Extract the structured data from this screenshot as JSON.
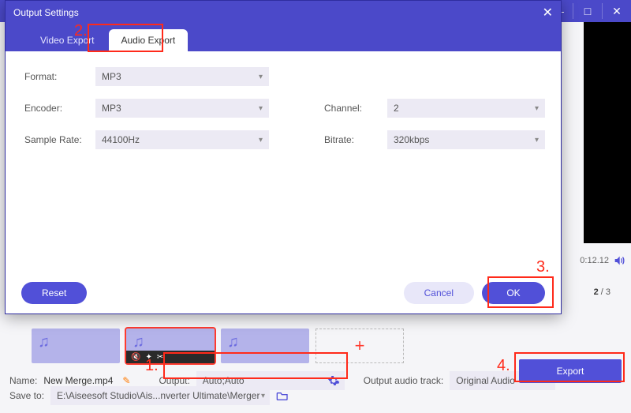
{
  "app": {
    "window_buttons": {
      "min": "—",
      "max": "□",
      "close": "✕"
    }
  },
  "preview": {
    "time": "0:12.12",
    "counter_current": "2",
    "counter_sep": " / ",
    "counter_total": "3"
  },
  "thumbs": {
    "plus": "+"
  },
  "bottom": {
    "name_label": "Name:",
    "name_value": "New Merge.mp4",
    "output_label": "Output:",
    "output_value": "Auto;Auto",
    "track_label": "Output audio track:",
    "track_value": "Original Audio",
    "export_label": "Export",
    "save_label": "Save to:",
    "save_value": "E:\\Aiseesoft Studio\\Ais...nverter Ultimate\\Merger"
  },
  "dialog": {
    "title": "Output Settings",
    "tabs": {
      "video": "Video Export",
      "audio": "Audio Export"
    },
    "fields": {
      "format_label": "Format:",
      "format_value": "MP3",
      "encoder_label": "Encoder:",
      "encoder_value": "MP3",
      "channel_label": "Channel:",
      "channel_value": "2",
      "samplerate_label": "Sample Rate:",
      "samplerate_value": "44100Hz",
      "bitrate_label": "Bitrate:",
      "bitrate_value": "320kbps"
    },
    "buttons": {
      "reset": "Reset",
      "cancel": "Cancel",
      "ok": "OK"
    },
    "close": "✕"
  },
  "callouts": {
    "n1": "1.",
    "n2": "2.",
    "n3": "3.",
    "n4": "4."
  },
  "glyphs": {
    "caret": "▾",
    "pen": "✎",
    "note": "♫",
    "mute": "🔇",
    "star": "✦",
    "cut": "✂"
  }
}
